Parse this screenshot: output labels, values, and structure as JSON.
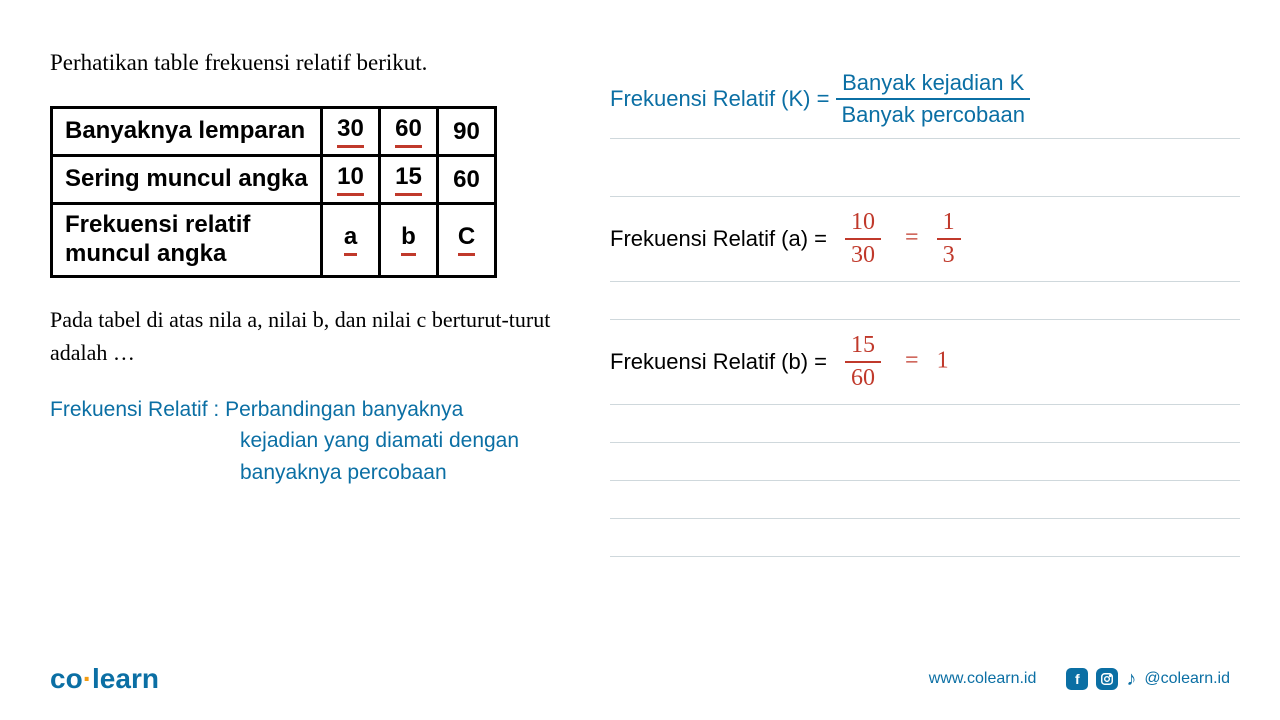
{
  "title": "Perhatikan table frekuensi relatif berikut.",
  "table": {
    "rows": [
      {
        "label": "Banyaknya lemparan",
        "c1": "30",
        "c2": "60",
        "c3": "90"
      },
      {
        "label": "Sering muncul angka",
        "c1": "10",
        "c2": "15",
        "c3": "60"
      },
      {
        "label": "Frekuensi relatif muncul angka",
        "c1": "a",
        "c2": "b",
        "c3": "C"
      }
    ]
  },
  "question": "Pada tabel di atas nila a, nilai b, dan nilai c berturut-turut adalah …",
  "definition": {
    "label": "Frekuensi Relatif :",
    "line1": "Perbandingan banyaknya",
    "line2": "kejadian yang diamati dengan",
    "line3": "banyaknya percobaan"
  },
  "formula": {
    "lhs": "Frekuensi Relatif (K) =",
    "numerator": "Banyak kejadian K",
    "denominator": "Banyak percobaan"
  },
  "calc_a": {
    "label": "Frekuensi Relatif (a) =",
    "frac1_top": "10",
    "frac1_bot": "30",
    "eq": "=",
    "frac2_top": "1",
    "frac2_bot": "3"
  },
  "calc_b": {
    "label": "Frekuensi Relatif (b) =",
    "frac1_top": "15",
    "frac1_bot": "60",
    "eq": "=",
    "frac2_top": "1",
    "frac2_bot": ""
  },
  "footer": {
    "logo_co": "co",
    "logo_learn": "learn",
    "url": "www.colearn.id",
    "handle": "@colearn.id"
  },
  "chart_data": {
    "type": "table",
    "columns": [
      "Banyaknya lemparan",
      "Sering muncul angka",
      "Frekuensi relatif muncul angka"
    ],
    "data": [
      {
        "Banyaknya lemparan": 30,
        "Sering muncul angka": 10,
        "Frekuensi relatif muncul angka": "a"
      },
      {
        "Banyaknya lemparan": 60,
        "Sering muncul angka": 15,
        "Frekuensi relatif muncul angka": "b"
      },
      {
        "Banyaknya lemparan": 90,
        "Sering muncul angka": 60,
        "Frekuensi relatif muncul angka": "c"
      }
    ],
    "computed": {
      "a": "10/30 = 1/3",
      "b": "15/60"
    }
  }
}
